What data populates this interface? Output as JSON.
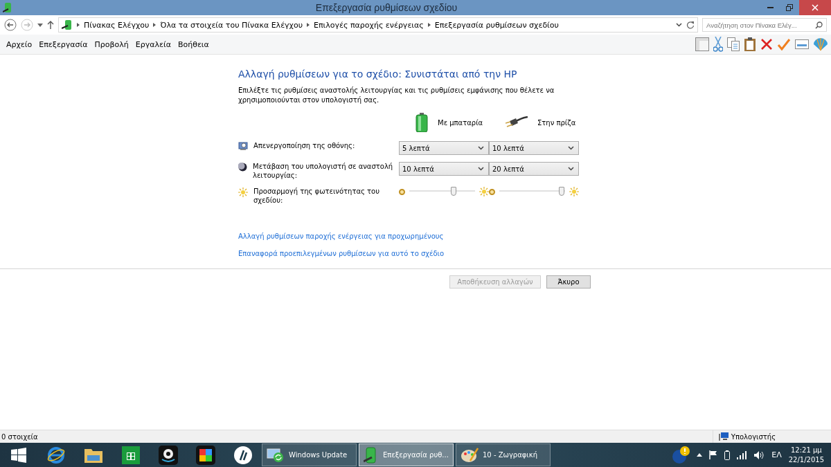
{
  "window": {
    "title": "Επεξεργασία ρυθμίσεων σχεδίου"
  },
  "address_bar": {
    "breadcrumbs": [
      "Πίνακας Ελέγχου",
      "Όλα τα στοιχεία του Πίνακα Ελέγχου",
      "Επιλογές παροχής ενέργειας",
      "Επεξεργασία ρυθμίσεων σχεδίου"
    ]
  },
  "search": {
    "placeholder": "Αναζήτηση στον Πίνακα Ελέγ..."
  },
  "menu": [
    "Αρχείο",
    "Επεξεργασία",
    "Προβολή",
    "Εργαλεία",
    "Βοήθεια"
  ],
  "heading": "Αλλαγή ρυθμίσεων για το σχέδιο: Συνιστάται από την HP",
  "description": "Επιλέξτε τις ρυθμίσεις αναστολής λειτουργίας και τις ρυθμίσεις εμφάνισης που θέλετε να χρησιμοποιούνται στον υπολογιστή σας.",
  "columns": [
    {
      "label": "Με μπαταρία",
      "kind": "battery"
    },
    {
      "label": "Στην πρίζα",
      "kind": "plug"
    }
  ],
  "settings": [
    {
      "label": "Απενεργοποίηση της οθόνης:",
      "kind": "dropdown",
      "values": [
        "5 λεπτά",
        "10 λεπτά"
      ]
    },
    {
      "label": "Μετάβαση του υπολογιστή σε αναστολή λειτουργίας:",
      "kind": "dropdown",
      "values": [
        "10 λεπτά",
        "20 λεπτά"
      ]
    },
    {
      "label": "Προσαρμογή της φωτεινότητας του σχεδίου:",
      "kind": "slider",
      "sliders": [
        {
          "level": 0.67
        },
        {
          "level": 0.95
        }
      ]
    }
  ],
  "links": [
    "Αλλαγή ρυθμίσεων παροχής ενέργειας για προχωρημένους",
    "Επαναφορά προεπιλεγμένων ρυθμίσεων για αυτό το σχέδιο"
  ],
  "buttons": [
    {
      "label": "Αποθήκευση αλλαγών",
      "disabled": true
    },
    {
      "label": "Άκυρο",
      "disabled": false
    }
  ],
  "status_bar": {
    "items": "0 στοιχεία",
    "zone": "Υπολογιστής"
  },
  "taskbar": {
    "tasks": [
      {
        "label": "Windows Update",
        "kind": "update",
        "selected": false
      },
      {
        "label": "Επεξεργασία ρυθ...",
        "kind": "power",
        "selected": true
      },
      {
        "label": "10 - Ζωγραφική",
        "kind": "paint",
        "selected": false
      }
    ],
    "language": "ΕΛ",
    "time": "12:21 μμ",
    "date": "22/1/2015"
  }
}
